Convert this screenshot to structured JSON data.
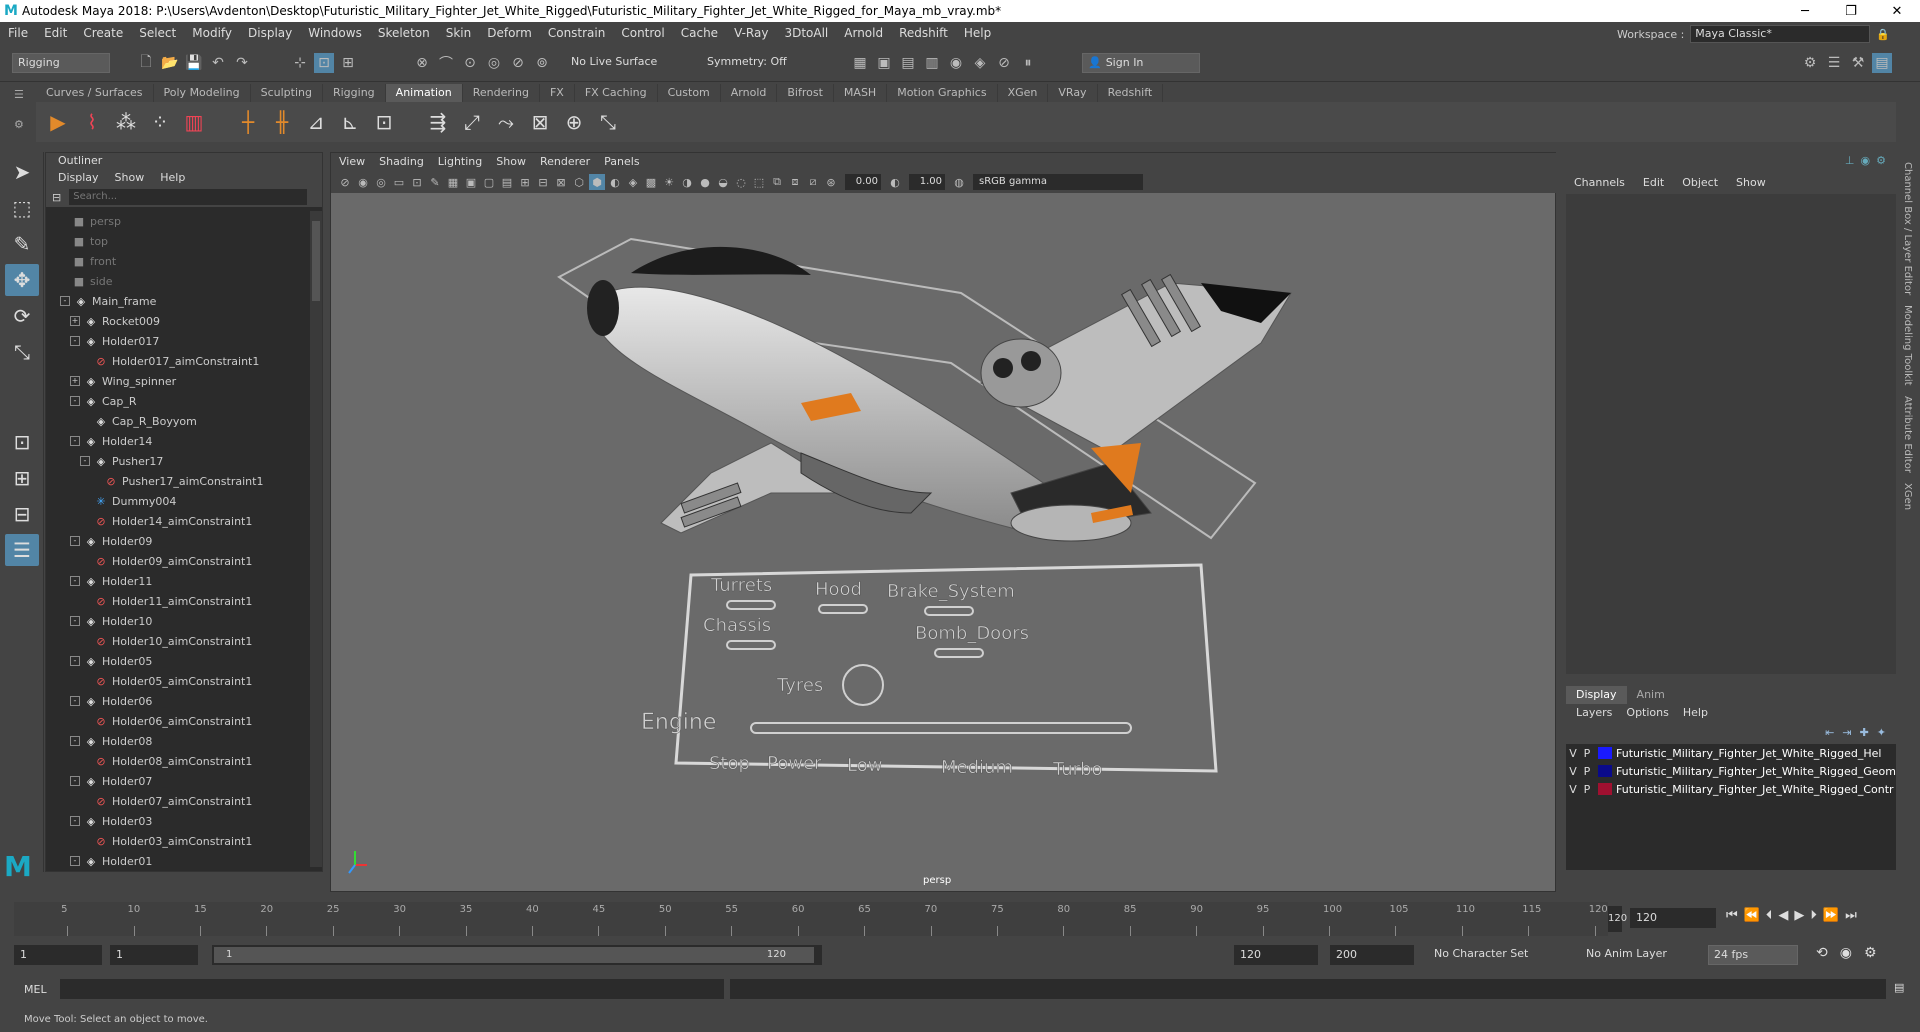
{
  "window": {
    "title": "Autodesk Maya 2018: P:\\Users\\Avdenton\\Desktop\\Futuristic_Military_Fighter_Jet_White_Rigged\\Futuristic_Military_Fighter_Jet_White_Rigged_for_Maya_mb_vray.mb*",
    "logo": "M"
  },
  "menubar": [
    "File",
    "Edit",
    "Create",
    "Select",
    "Modify",
    "Display",
    "Windows",
    "Skeleton",
    "Skin",
    "Deform",
    "Constrain",
    "Control",
    "Cache",
    "V-Ray",
    "3DtoAll",
    "Arnold",
    "Redshift",
    "Help"
  ],
  "workspace": {
    "label": "Workspace :",
    "value": "Maya Classic*"
  },
  "statusline": {
    "mode": "Rigging",
    "live_surface": "No Live Surface",
    "symmetry": "Symmetry: Off",
    "sign_in": "Sign In"
  },
  "shelf_tabs": [
    "Curves / Surfaces",
    "Poly Modeling",
    "Sculpting",
    "Rigging",
    "Animation",
    "Rendering",
    "FX",
    "FX Caching",
    "Custom",
    "Arnold",
    "Bifrost",
    "MASH",
    "Motion Graphics",
    "XGen",
    "VRay",
    "Redshift"
  ],
  "active_shelf": "Animation",
  "outliner": {
    "title": "Outliner",
    "menu": [
      "Display",
      "Show",
      "Help"
    ],
    "search_placeholder": "Search...",
    "items": [
      {
        "label": "persp",
        "type": "camera",
        "depth": 0
      },
      {
        "label": "top",
        "type": "camera",
        "depth": 0
      },
      {
        "label": "front",
        "type": "camera",
        "depth": 0
      },
      {
        "label": "side",
        "type": "camera",
        "depth": 0
      },
      {
        "label": "Main_frame",
        "type": "transform",
        "depth": 0,
        "expand": "-"
      },
      {
        "label": "Rocket009",
        "type": "transform",
        "depth": 1,
        "expand": "+"
      },
      {
        "label": "Holder017",
        "type": "transform",
        "depth": 1,
        "expand": "-"
      },
      {
        "label": "Holder017_aimConstraint1",
        "type": "constraint",
        "depth": 2
      },
      {
        "label": "Wing_spinner",
        "type": "transform",
        "depth": 1,
        "expand": "+"
      },
      {
        "label": "Cap_R",
        "type": "transform",
        "depth": 1,
        "expand": "-"
      },
      {
        "label": "Cap_R_Boyyom",
        "type": "transform",
        "depth": 2
      },
      {
        "label": "Holder14",
        "type": "transform",
        "depth": 1,
        "expand": "-"
      },
      {
        "label": "Pusher17",
        "type": "transform",
        "depth": 2,
        "expand": "-"
      },
      {
        "label": "Pusher17_aimConstraint1",
        "type": "constraint",
        "depth": 3
      },
      {
        "label": "Dummy004",
        "type": "dummy",
        "depth": 2
      },
      {
        "label": "Holder14_aimConstraint1",
        "type": "constraint",
        "depth": 2
      },
      {
        "label": "Holder09",
        "type": "transform",
        "depth": 1,
        "expand": "-"
      },
      {
        "label": "Holder09_aimConstraint1",
        "type": "constraint",
        "depth": 2
      },
      {
        "label": "Holder11",
        "type": "transform",
        "depth": 1,
        "expand": "-"
      },
      {
        "label": "Holder11_aimConstraint1",
        "type": "constraint",
        "depth": 2
      },
      {
        "label": "Holder10",
        "type": "transform",
        "depth": 1,
        "expand": "-"
      },
      {
        "label": "Holder10_aimConstraint1",
        "type": "constraint",
        "depth": 2
      },
      {
        "label": "Holder05",
        "type": "transform",
        "depth": 1,
        "expand": "-"
      },
      {
        "label": "Holder05_aimConstraint1",
        "type": "constraint",
        "depth": 2
      },
      {
        "label": "Holder06",
        "type": "transform",
        "depth": 1,
        "expand": "-"
      },
      {
        "label": "Holder06_aimConstraint1",
        "type": "constraint",
        "depth": 2
      },
      {
        "label": "Holder08",
        "type": "transform",
        "depth": 1,
        "expand": "-"
      },
      {
        "label": "Holder08_aimConstraint1",
        "type": "constraint",
        "depth": 2
      },
      {
        "label": "Holder07",
        "type": "transform",
        "depth": 1,
        "expand": "-"
      },
      {
        "label": "Holder07_aimConstraint1",
        "type": "constraint",
        "depth": 2
      },
      {
        "label": "Holder03",
        "type": "transform",
        "depth": 1,
        "expand": "-"
      },
      {
        "label": "Holder03_aimConstraint1",
        "type": "constraint",
        "depth": 2
      },
      {
        "label": "Holder01",
        "type": "transform",
        "depth": 1,
        "expand": "-"
      }
    ]
  },
  "viewport": {
    "menu": [
      "View",
      "Shading",
      "Lighting",
      "Show",
      "Renderer",
      "Panels"
    ],
    "near": "0.00",
    "far": "1.00",
    "color_space": "sRGB gamma",
    "camera": "persp",
    "control_labels": [
      "Turrets",
      "Hood",
      "Brake_System",
      "Chassis",
      "Bomb_Doors",
      "Tyres",
      "Engine",
      "Stop",
      "Power",
      "Low",
      "Medium",
      "Turbo"
    ]
  },
  "channel_box": {
    "menu": [
      "Channels",
      "Edit",
      "Object",
      "Show"
    ],
    "layer_tabs": [
      "Display",
      "Anim"
    ],
    "layer_menu": [
      "Layers",
      "Options",
      "Help"
    ],
    "layers": [
      {
        "v": "V",
        "p": "P",
        "name": "Futuristic_Military_Fighter_Jet_White_Rigged_Hel",
        "color": "#1a1aff"
      },
      {
        "v": "V",
        "p": "P",
        "name": "Futuristic_Military_Fighter_Jet_White_Rigged_Geom",
        "color": "#0a0a8a"
      },
      {
        "v": "V",
        "p": "P",
        "name": "Futuristic_Military_Fighter_Jet_White_Rigged_Contr",
        "color": "#a01030"
      }
    ]
  },
  "side_tabs": [
    "Channel Box / Layer Editor",
    "Modeling Toolkit",
    "Attribute Editor",
    "XGen"
  ],
  "timeline": {
    "ticks": [
      "5",
      "10",
      "15",
      "20",
      "25",
      "30",
      "35",
      "40",
      "45",
      "50",
      "55",
      "60",
      "65",
      "70",
      "75",
      "80",
      "85",
      "90",
      "95",
      "100",
      "105",
      "110",
      "115",
      "120"
    ],
    "current_frame": "120",
    "current_field": "120"
  },
  "range": {
    "start": "1",
    "playback_start": "1",
    "slider_start": "1",
    "slider_end": "120",
    "playback_end": "120",
    "end": "200",
    "character_set": "No Character Set",
    "anim_layer": "No Anim Layer",
    "fps": "24 fps"
  },
  "cmd": {
    "label": "MEL"
  },
  "help_line": "Move Tool: Select an object to move."
}
